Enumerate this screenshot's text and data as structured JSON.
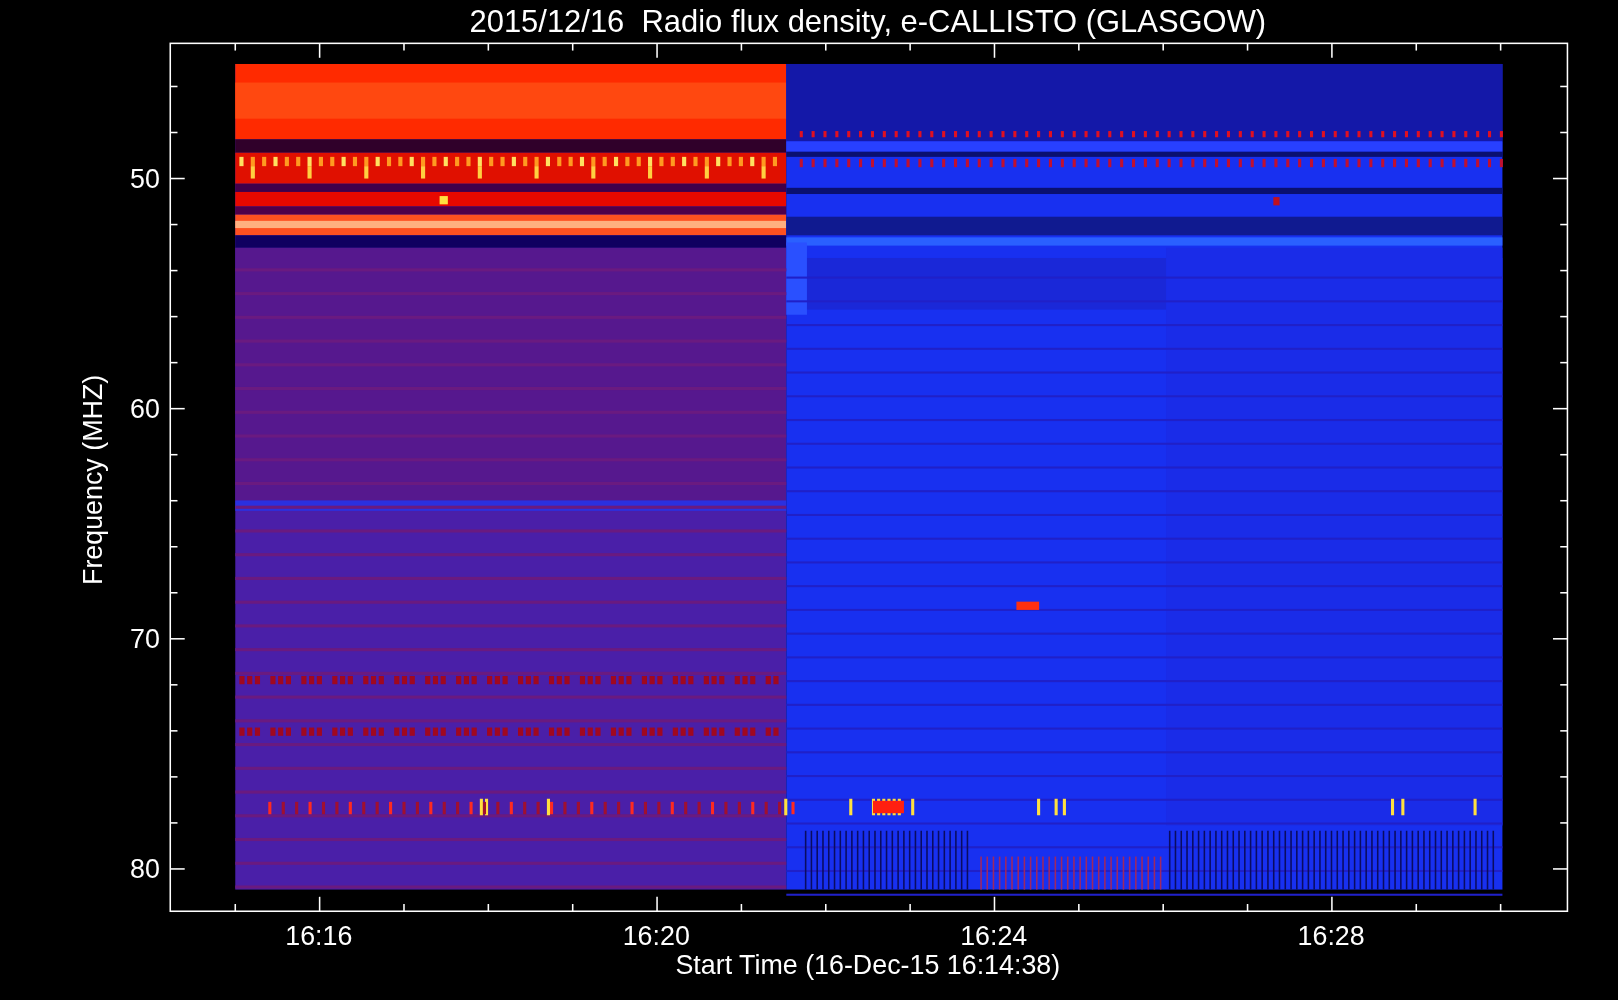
{
  "title": "2015/12/16  Radio flux density, e-CALLISTO (GLASGOW)",
  "y_axis": {
    "label": "Frequency (MHZ)",
    "tick_labels": [
      "50",
      "60",
      "70",
      "80"
    ]
  },
  "x_axis": {
    "label": "Start Time (16-Dec-15 16:14:38)",
    "tick_labels": [
      "16:16",
      "16:20",
      "16:24",
      "16:28"
    ]
  }
}
